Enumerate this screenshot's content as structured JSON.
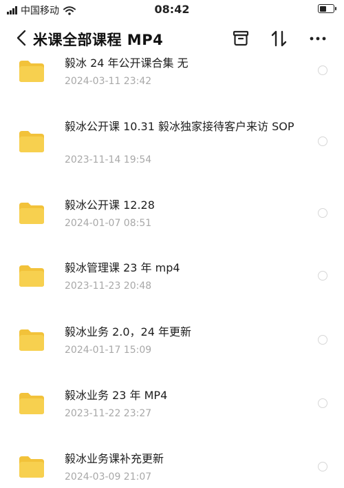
{
  "status_bar": {
    "carrier": "中国移动",
    "time": "08:42"
  },
  "header": {
    "title": "米课全部课程 MP4"
  },
  "files": [
    {
      "name": "毅冰 24 年公开课合集 无",
      "date": "2024-03-11 23:42"
    },
    {
      "name": "毅冰公开课 10.31 毅冰独家接待客户来访 SOP",
      "date": "2023-11-14 19:54"
    },
    {
      "name": "毅冰公开课 12.28",
      "date": "2024-01-07 08:51"
    },
    {
      "name": "毅冰管理课 23 年 mp4",
      "date": "2023-11-23 20:48"
    },
    {
      "name": "毅冰业务 2.0，24 年更新",
      "date": "2024-01-17 15:09"
    },
    {
      "name": "毅冰业务 23 年 MP4",
      "date": "2023-11-22 23:27"
    },
    {
      "name": "毅冰业务课补充更新",
      "date": "2024-03-09 21:07"
    }
  ],
  "colors": {
    "folder": "#f7d04f",
    "folder_tab": "#f2c23a",
    "date_text": "#a8a8a8",
    "radio_border": "#d6d6d6"
  }
}
